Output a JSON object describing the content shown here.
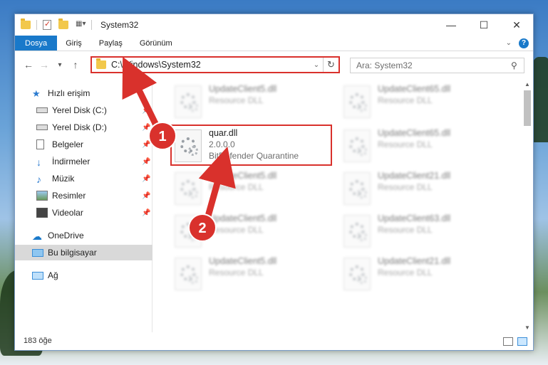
{
  "window": {
    "title": "System32",
    "controls": {
      "minimize": "—",
      "maximize": "☐",
      "close": "✕"
    }
  },
  "ribbon": {
    "tabs": [
      "Dosya",
      "Giriş",
      "Paylaş",
      "Görünüm"
    ],
    "expand_icon": "chevron-down-icon",
    "help_label": "?"
  },
  "navigation": {
    "back": "←",
    "forward": "→",
    "recent": "▾",
    "up": "↑",
    "address": "C:\\Windows\\System32",
    "search_placeholder": "Ara: System32"
  },
  "sidebar": {
    "items": [
      {
        "label": "Hızlı erişim",
        "icon": "star-icon"
      },
      {
        "label": "Yerel Disk (C:)",
        "icon": "drive-icon",
        "pinned": true
      },
      {
        "label": "Yerel Disk (D:)",
        "icon": "drive-icon",
        "pinned": true
      },
      {
        "label": "Belgeler",
        "icon": "document-icon",
        "pinned": true
      },
      {
        "label": "İndirmeler",
        "icon": "download-icon",
        "pinned": true
      },
      {
        "label": "Müzik",
        "icon": "music-icon",
        "pinned": true
      },
      {
        "label": "Resimler",
        "icon": "pictures-icon",
        "pinned": true
      },
      {
        "label": "Videolar",
        "icon": "video-icon",
        "pinned": true
      },
      {
        "label": "OneDrive",
        "icon": "cloud-icon"
      },
      {
        "label": "Bu bilgisayar",
        "icon": "computer-icon",
        "selected": true
      },
      {
        "label": "Ağ",
        "icon": "network-icon"
      }
    ]
  },
  "files": {
    "highlighted": {
      "name": "quar.dll",
      "version": "2.0.0.0",
      "description": "BitDefender Quarantine"
    },
    "background_left": [
      {
        "name": "UpdateClient5.dll",
        "description": "Resource DLL"
      },
      {
        "name": "UpdateClient5.dll",
        "description": "Resource DLL"
      },
      {
        "name": "UpdateClient5.dll",
        "description": "Resource DLL"
      },
      {
        "name": "UpdateClient5.dll",
        "description": "Resource DLL"
      },
      {
        "name": "UpdateClient5.dll",
        "description": "Resource DLL"
      }
    ],
    "background_right": [
      {
        "name": "UpdateClient65.dll",
        "description": "Resource DLL"
      },
      {
        "name": "UpdateClient65.dll",
        "description": "Resource DLL"
      },
      {
        "name": "UpdateClient21.dll",
        "description": "Resource DLL"
      },
      {
        "name": "UpdateClient63.dll",
        "description": "Resource DLL"
      },
      {
        "name": "UpdateClient21.dll",
        "description": "Resource DLL"
      }
    ]
  },
  "status": {
    "count": "183 öğe"
  },
  "annotations": {
    "step1": "1",
    "step2": "2",
    "color": "#d9312c"
  }
}
